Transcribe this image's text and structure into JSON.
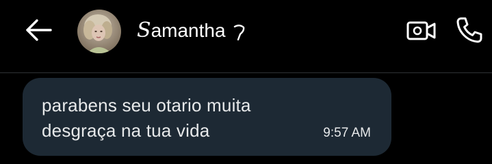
{
  "header": {
    "back_icon": "arrow-left-icon",
    "avatar_icon": "profile-photo",
    "contact_name_initial": "S",
    "contact_name_rest": "amantha",
    "contact_name_suffix": "♡",
    "video_icon": "video-camera-icon",
    "call_icon": "phone-icon"
  },
  "messages": [
    {
      "lines": [
        "parabens seu otario muita",
        "desgraça na tua vida"
      ],
      "time": "9:57 AM",
      "direction": "incoming"
    }
  ],
  "colors": {
    "background": "#000000",
    "bubble": "#1d2934",
    "text": "#e7e9ea",
    "divider": "#2f3336"
  }
}
